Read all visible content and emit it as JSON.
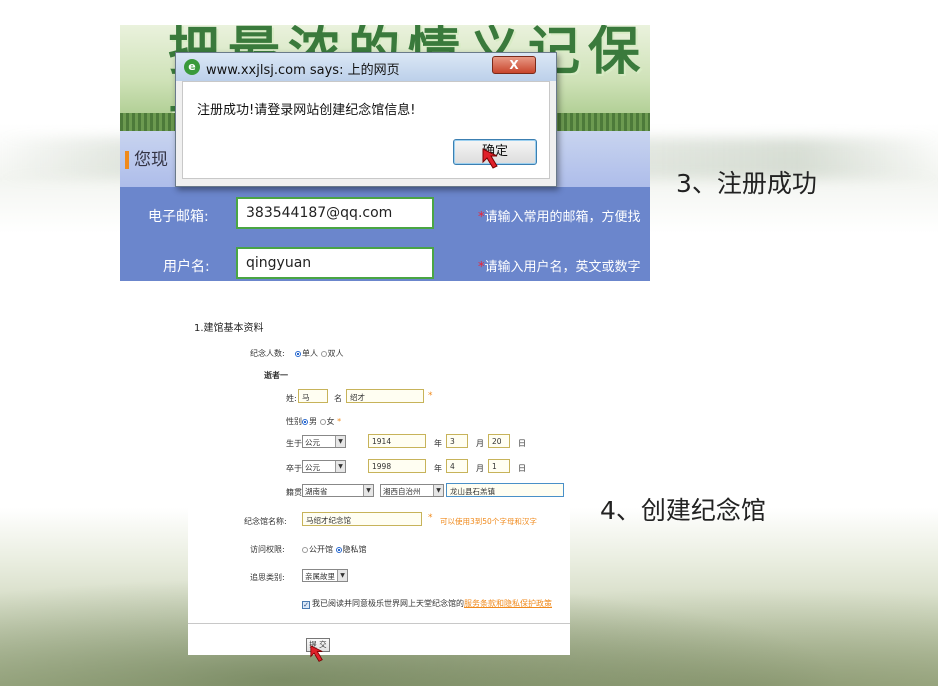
{
  "top_screenshot": {
    "banner_title": "把最浓的情义记保存下来",
    "section_title": "您现",
    "email": {
      "label": "电子邮箱:",
      "value": "383544187@qq.com",
      "hint_star": "*",
      "hint": "请输入常用的邮箱，方便找"
    },
    "username": {
      "label": "用户名:",
      "value": "qingyuan",
      "hint_star": "*",
      "hint": "请输入用户名，英文或数字"
    },
    "dialog": {
      "title": "www.xxjlsj.com says: 上的网页",
      "close_label": "X",
      "message": "注册成功!请登录网站创建纪念馆信息!",
      "ok_label": "确定"
    }
  },
  "captions": {
    "step3": "3、注册成功",
    "step4": "4、创建纪念馆"
  },
  "bottom_screenshot": {
    "section_title": "1.建馆基本资料",
    "person_count": {
      "label": "纪念人数:",
      "options": [
        "单人",
        "双人"
      ],
      "selected": "单人"
    },
    "deceased_heading": "逝者一",
    "surname": {
      "label": "姓:",
      "value": "马"
    },
    "given_name": {
      "label": "名",
      "value": "绍才"
    },
    "required_star": "*",
    "gender": {
      "label": "性别:",
      "options": [
        "男",
        "女"
      ],
      "selected": "男"
    },
    "born": {
      "label": "生于:",
      "era": "公元",
      "year": "1914",
      "year_unit": "年",
      "month": "3",
      "month_unit": "月",
      "day": "20",
      "day_unit": "日"
    },
    "died": {
      "label": "卒于:",
      "era": "公元",
      "year": "1998",
      "year_unit": "年",
      "month": "4",
      "month_unit": "月",
      "day": "1",
      "day_unit": "日"
    },
    "origin": {
      "label": "籍贯:",
      "province": "湖南省",
      "prefecture": "湘西自治州",
      "detail": "龙山县石羔镇"
    },
    "hall_name": {
      "label": "纪念馆名称:",
      "value": "马绍才纪念馆",
      "hint": "可以使用3到50个字母和汉字"
    },
    "access": {
      "label": "访问权限:",
      "options": [
        "公开馆",
        "隐私馆"
      ],
      "selected": "隐私馆"
    },
    "category": {
      "label": "追思类别:",
      "value": "亲属故里"
    },
    "agreement": {
      "prefix": "我已阅读并同意极乐世界网上天堂纪念馆的",
      "link": "服务条款和隐私保护政策"
    },
    "submit_label": "提 交"
  },
  "colors": {
    "form_bg": "#6b86cc",
    "input_border": "#4aa544",
    "accent_orange": "#f08a1c",
    "required_red": "#e22233"
  }
}
